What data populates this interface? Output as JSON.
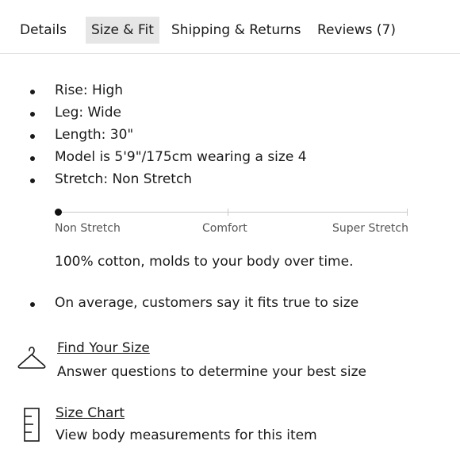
{
  "tabs": [
    {
      "label": "Details"
    },
    {
      "label": "Size & Fit"
    },
    {
      "label": "Shipping & Returns"
    },
    {
      "label": "Reviews (7)"
    }
  ],
  "fit_details": [
    "Rise: High",
    "Leg: Wide",
    "Length: 30\"",
    "Model is 5'9\"/175cm wearing a size 4",
    "Stretch: Non Stretch"
  ],
  "stretch_scale": {
    "labels": [
      "Non Stretch",
      "Comfort",
      "Super Stretch"
    ],
    "selected": "Non Stretch"
  },
  "fabric_note": "100% cotton, molds to your body over time.",
  "customer_fit": "On average, customers say it fits true to size",
  "find_your_size": {
    "title": "Find Your Size",
    "subtitle": "Answer questions to determine your best size",
    "icon": "hanger-icon"
  },
  "size_chart": {
    "title": "Size Chart",
    "subtitle": "View body measurements for this item",
    "icon": "ruler-icon"
  }
}
